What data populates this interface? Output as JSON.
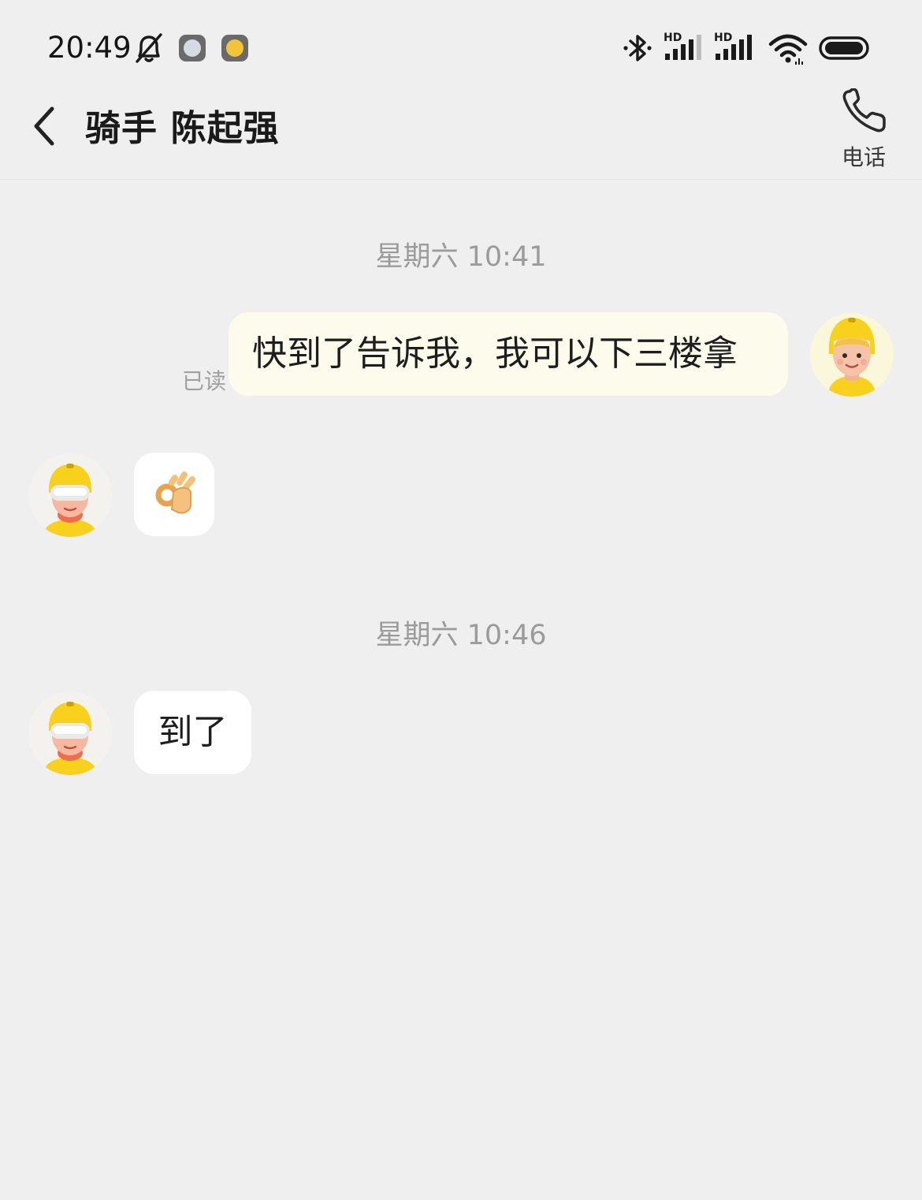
{
  "status_bar": {
    "time": "20:49",
    "icons": [
      "bell-off-icon",
      "chat-notification-icon",
      "face-notification-icon",
      "bluetooth-icon",
      "signal-hd-icon",
      "signal-hd-icon",
      "wifi-icon",
      "battery-icon"
    ],
    "signal_labels": [
      "HD",
      "HD"
    ]
  },
  "header": {
    "title": "骑手 陈起强",
    "phone_label": "电话"
  },
  "colors": {
    "background": "#efefef",
    "outgoing_bubble": "#fdfbec",
    "incoming_bubble": "#ffffff",
    "rider_yellow": "#f7d11c",
    "timestamp_text": "#9b9b9b"
  },
  "conversation": {
    "timestamp_1": "星期六 10:41",
    "outgoing_message": "快到了告诉我，我可以下三楼拿",
    "read_status": "已读",
    "incoming_emoji": "ok-hand-emoji",
    "timestamp_2": "星期六 10:46",
    "incoming_message": "到了"
  }
}
